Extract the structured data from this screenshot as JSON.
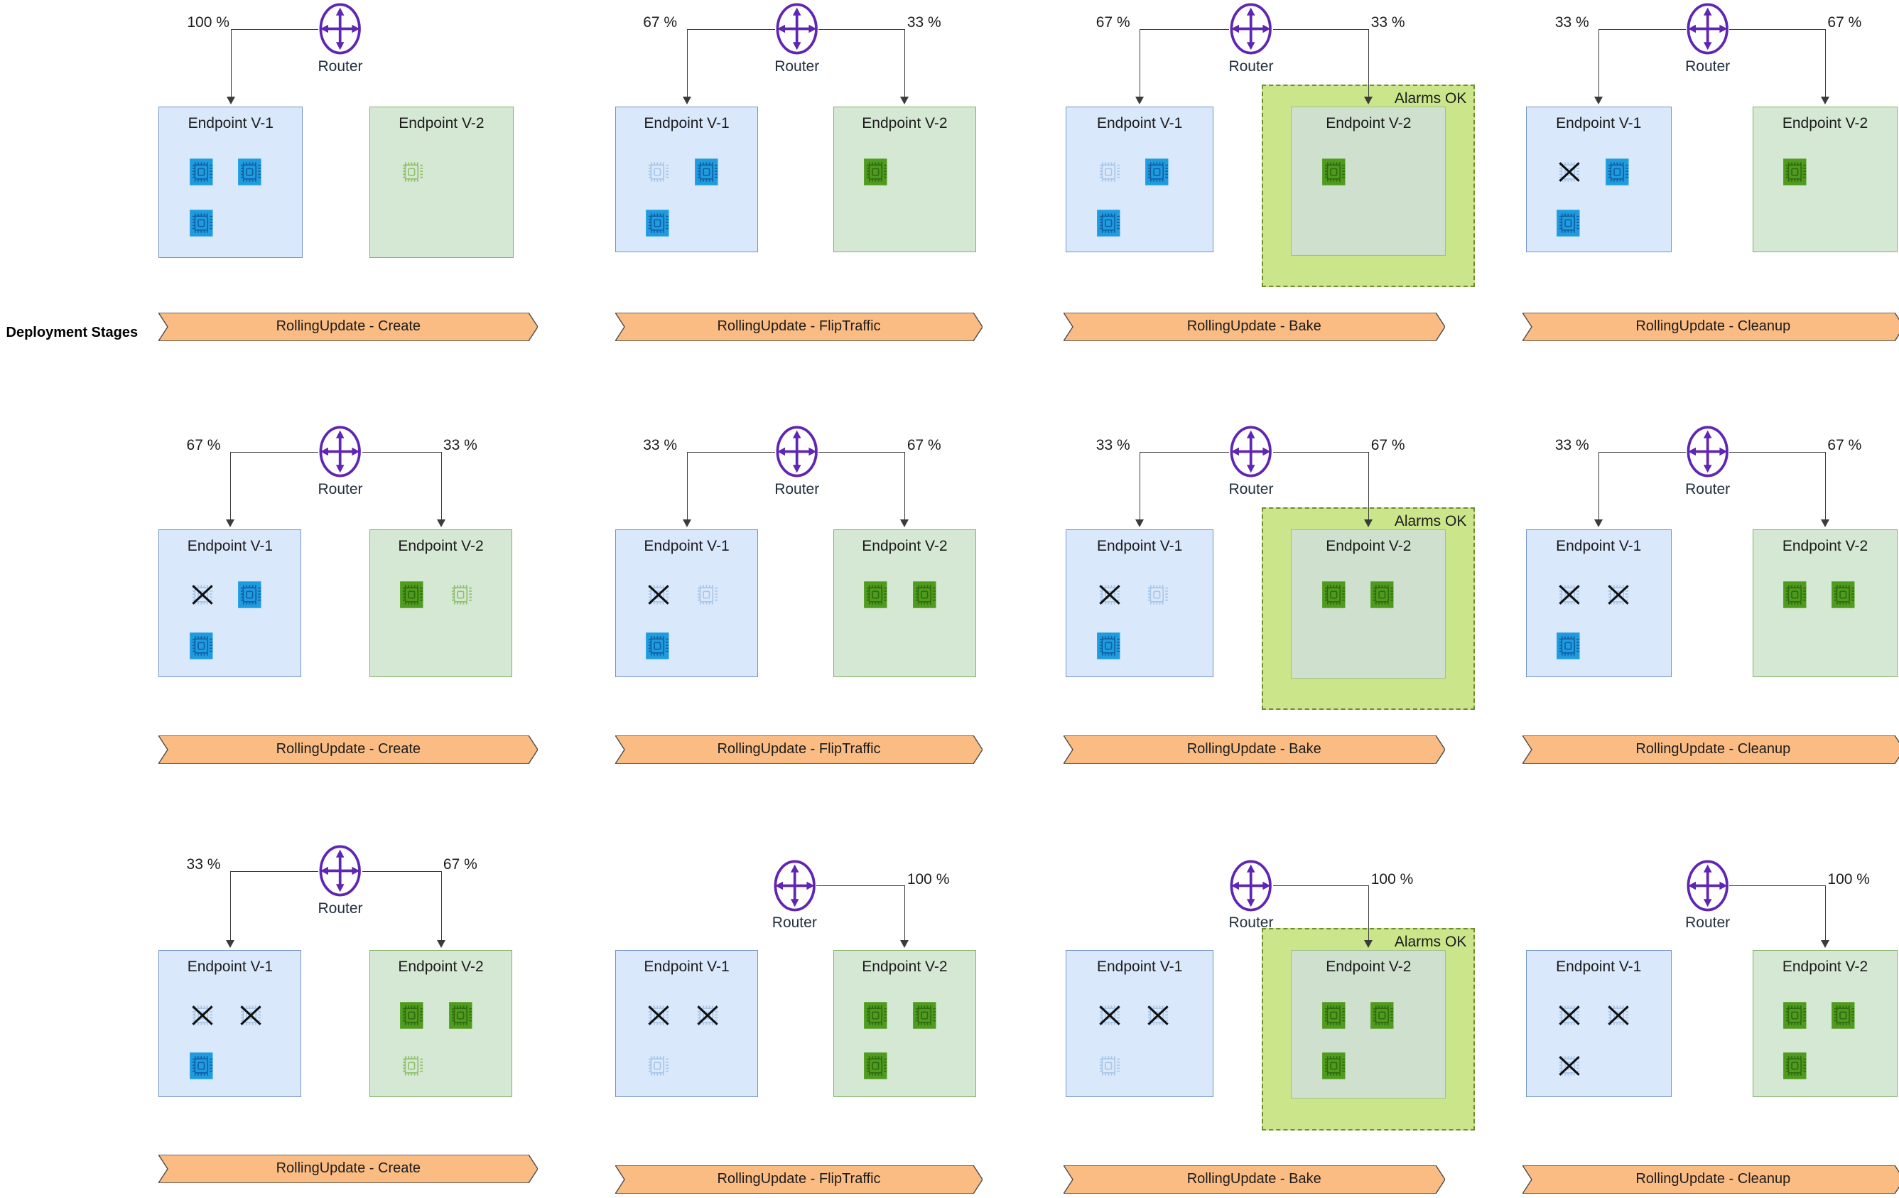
{
  "diagram": {
    "stages_axis_label": "Deployment Stages",
    "router_label": "Router",
    "endpoint_v1_label": "Endpoint V-1",
    "endpoint_v2_label": "Endpoint V-2",
    "alarms_label": "Alarms OK",
    "colors": {
      "v1_box_fill": "#dae8fc",
      "v1_box_stroke": "#7294c4",
      "v2_box_fill": "#d5e8d4",
      "v2_box_stroke": "#82b366",
      "alarm_fill": "#cbe58b",
      "alarm_stroke": "#6d8c34",
      "chip_blue_active": "#1f9ce0",
      "chip_blue_glyph": "#1060a3",
      "chip_green_active": "#4f9b1e",
      "chip_green_glyph": "#2f6b10",
      "chip_ghost_blue": "#a8c6e8",
      "chip_ghost_green": "#8fc06a",
      "banner_fill": "#fbbc84",
      "banner_stroke": "#4a4a4a",
      "router_purple": "#5f25b3",
      "edge": "#3b3b3b"
    },
    "stage_names": [
      "RollingUpdate - Create",
      "RollingUpdate - FlipTraffic",
      "RollingUpdate - Bake",
      "RollingUpdate - Cleanup"
    ],
    "chip_states": {
      "active": "chip-active-icon",
      "ghost": "chip-pending-icon",
      "terminated": "chip-terminated-icon"
    },
    "rows": [
      {
        "row_index": 1,
        "cells": [
          {
            "stage": "RollingUpdate - Create",
            "traffic": {
              "v1": "100 %",
              "v2": null
            },
            "v1_chips": [
              "active",
              "active",
              "active"
            ],
            "v2_chips": [
              "ghost"
            ],
            "alarms_ok": false
          },
          {
            "stage": "RollingUpdate - FlipTraffic",
            "traffic": {
              "v1": "67 %",
              "v2": "33 %"
            },
            "v1_chips": [
              "ghost",
              "active",
              "active"
            ],
            "v2_chips": [
              "active"
            ],
            "alarms_ok": false
          },
          {
            "stage": "RollingUpdate - Bake",
            "traffic": {
              "v1": "67 %",
              "v2": "33 %"
            },
            "v1_chips": [
              "ghost",
              "active",
              "active"
            ],
            "v2_chips": [
              "active"
            ],
            "alarms_ok": true
          },
          {
            "stage": "RollingUpdate - Cleanup",
            "traffic": {
              "v1": "33 %",
              "v2": "67 %"
            },
            "v1_chips": [
              "terminated",
              "active",
              "active"
            ],
            "v2_chips": [
              "active"
            ],
            "alarms_ok": false
          }
        ]
      },
      {
        "row_index": 2,
        "cells": [
          {
            "stage": "RollingUpdate - Create",
            "traffic": {
              "v1": "67 %",
              "v2": "33 %"
            },
            "v1_chips": [
              "terminated",
              "active",
              "active"
            ],
            "v2_chips": [
              "active",
              "ghost"
            ],
            "alarms_ok": false
          },
          {
            "stage": "RollingUpdate - FlipTraffic",
            "traffic": {
              "v1": "33 %",
              "v2": "67 %"
            },
            "v1_chips": [
              "terminated",
              "ghost",
              "active"
            ],
            "v2_chips": [
              "active",
              "active"
            ],
            "alarms_ok": false
          },
          {
            "stage": "RollingUpdate - Bake",
            "traffic": {
              "v1": "33 %",
              "v2": "67 %"
            },
            "v1_chips": [
              "terminated",
              "ghost",
              "active"
            ],
            "v2_chips": [
              "active",
              "active"
            ],
            "alarms_ok": true
          },
          {
            "stage": "RollingUpdate - Cleanup",
            "traffic": {
              "v1": "33 %",
              "v2": "67 %"
            },
            "v1_chips": [
              "terminated",
              "terminated",
              "active"
            ],
            "v2_chips": [
              "active",
              "active"
            ],
            "alarms_ok": false
          }
        ]
      },
      {
        "row_index": 3,
        "cells": [
          {
            "stage": "RollingUpdate - Create",
            "traffic": {
              "v1": "33 %",
              "v2": "67 %"
            },
            "v1_chips": [
              "terminated",
              "terminated",
              "active"
            ],
            "v2_chips": [
              "active",
              "active",
              "ghost"
            ],
            "alarms_ok": false
          },
          {
            "stage": "RollingUpdate - FlipTraffic",
            "traffic": {
              "v1": null,
              "v2": "100 %"
            },
            "v1_chips": [
              "terminated",
              "terminated",
              "ghost"
            ],
            "v2_chips": [
              "active",
              "active",
              "active"
            ],
            "alarms_ok": false
          },
          {
            "stage": "RollingUpdate - Bake",
            "traffic": {
              "v1": null,
              "v2": "100 %"
            },
            "v1_chips": [
              "terminated",
              "terminated",
              "ghost"
            ],
            "v2_chips": [
              "active",
              "active",
              "active"
            ],
            "alarms_ok": true
          },
          {
            "stage": "RollingUpdate - Cleanup",
            "traffic": {
              "v1": null,
              "v2": "100 %"
            },
            "v1_chips": [
              "terminated",
              "terminated",
              "terminated"
            ],
            "v2_chips": [
              "active",
              "active",
              "active"
            ],
            "alarms_ok": false
          }
        ]
      }
    ]
  }
}
